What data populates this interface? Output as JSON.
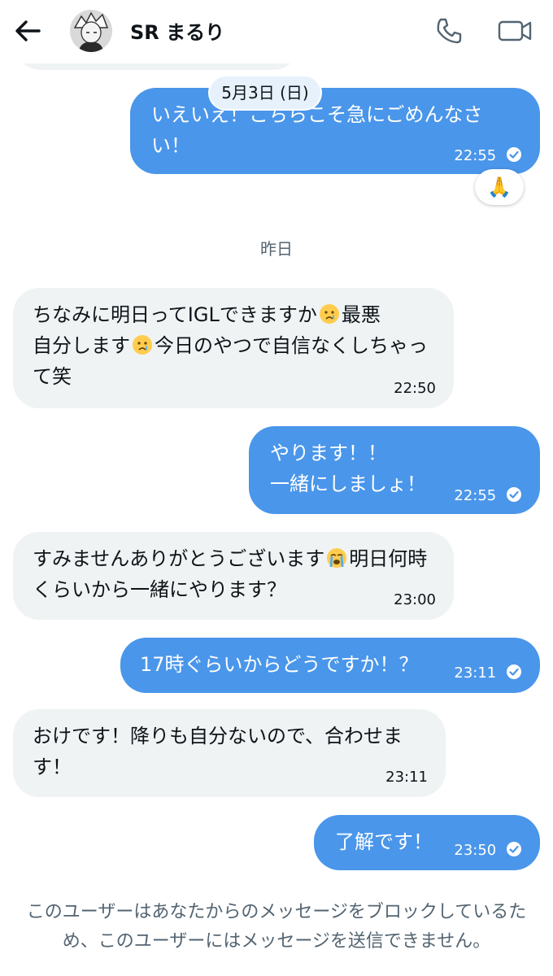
{
  "header": {
    "title": "SR まるり",
    "back_icon": "arrow-left-icon",
    "call_icon": "phone-icon",
    "video_icon": "video-camera-icon"
  },
  "conversation": {
    "date_label": "5月3日 (日)",
    "yesterday_label": "昨日",
    "messages": [
      {
        "dir": "out",
        "text": "いえいえ！こちらこそ急にごめんなさい！",
        "time": "22:55",
        "read": true,
        "reaction": "🙏"
      },
      {
        "dir": "in",
        "text_parts": [
          "ちなみに明日ってIGLできますか",
          "最悪",
          "自分します",
          "今日のやつで自信なくしちゃって笑"
        ],
        "time": "22:50"
      },
      {
        "dir": "out",
        "text": "やります！！\n一緒にしましょ！",
        "time": "22:55",
        "read": true
      },
      {
        "dir": "in",
        "text_parts": [
          "すみませんありがとうございます",
          "明日何時くらいから一緒にやります？"
        ],
        "time": "23:00"
      },
      {
        "dir": "out",
        "text": "17時ぐらいからどうですか！？",
        "time": "23:11",
        "read": true
      },
      {
        "dir": "in",
        "text": "おけです！降りも自分ないので、合わせます！",
        "time": "23:11"
      },
      {
        "dir": "out",
        "text": "了解です！",
        "time": "23:50",
        "read": true
      }
    ]
  },
  "footer": {
    "blocked_notice": "このユーザーはあなたからのメッセージをブロックしているため、このユーザーにはメッセージを送信できません。"
  },
  "colors": {
    "outgoing_bubble": "#4a96ea",
    "incoming_bubble": "#eff3f4",
    "muted_text": "#536471"
  }
}
